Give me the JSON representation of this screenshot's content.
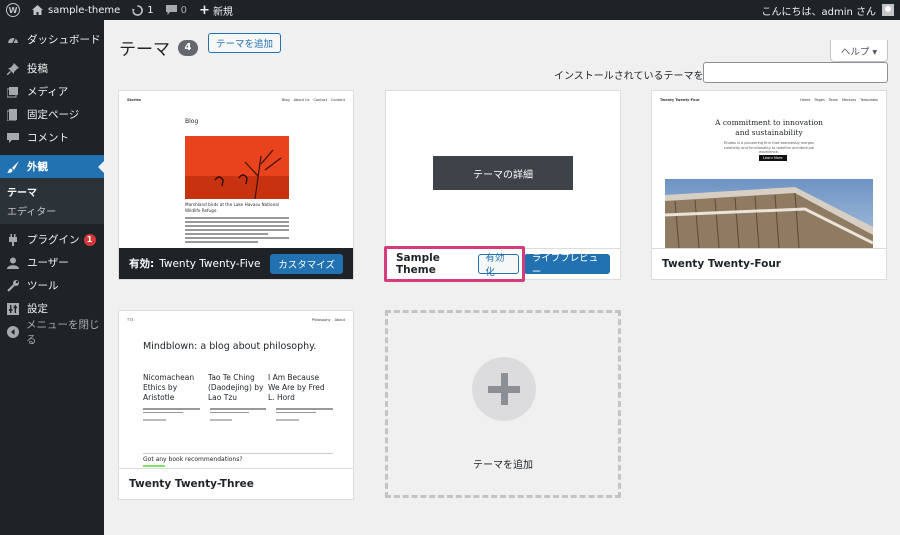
{
  "adminbar": {
    "site_name": "sample-theme",
    "updates_count": "1",
    "comments_count": "0",
    "new_label": "新規",
    "greeting": "こんにちは、admin さん"
  },
  "sidebar": {
    "items": [
      {
        "label": "ダッシュボード",
        "icon": "dashboard-icon"
      },
      {
        "label": "投稿",
        "icon": "pushpin-icon"
      },
      {
        "label": "メディア",
        "icon": "media-icon"
      },
      {
        "label": "固定ページ",
        "icon": "page-icon"
      },
      {
        "label": "コメント",
        "icon": "comment-icon"
      },
      {
        "label": "外観",
        "icon": "appearance-icon"
      },
      {
        "label": "プラグイン",
        "icon": "plugin-icon",
        "badge": "1"
      },
      {
        "label": "ユーザー",
        "icon": "user-icon"
      },
      {
        "label": "ツール",
        "icon": "tools-icon"
      },
      {
        "label": "設定",
        "icon": "settings-icon"
      }
    ],
    "submenu": [
      "テーマ",
      "エディター"
    ],
    "collapse_label": "メニューを閉じる"
  },
  "page": {
    "title": "テーマ",
    "count": "4",
    "add_button": "テーマを追加",
    "help": "ヘルプ ▾",
    "search_label": "インストールされているテーマを検索",
    "search_value": ""
  },
  "themes": [
    {
      "name": "Twenty Twenty-Five",
      "active_prefix": "有効:",
      "customize": "カスタマイズ",
      "preview": {
        "brand": "Stories",
        "nav": [
          "Blog",
          "About Us",
          "Contact",
          "Content"
        ],
        "heading": "Blog",
        "caption": "Marshland birds at the Lake Havasu National Wildlife Refuge"
      }
    },
    {
      "name": "Sample Theme",
      "details": "テーマの詳細",
      "activate": "有効化",
      "live_preview": "ライブプレビュー"
    },
    {
      "name": "Twenty Twenty-Four",
      "preview": {
        "brand": "Twenty Twenty-Four",
        "nav": [
          "Home",
          "Pages",
          "Team",
          "Mentors",
          "Templates"
        ],
        "heading": "A commitment to innovation and sustainability",
        "sub": "Études is a pioneering firm that seamlessly merges creativity and functionality to redefine architectural excellence.",
        "cta": "Learn More"
      }
    },
    {
      "name": "Twenty Twenty-Three",
      "preview": {
        "brand": "TT3",
        "nav": [
          "Philosophy",
          "About"
        ],
        "heading": "Mindblown: a blog about philosophy.",
        "posts": [
          "Nicomachean Ethics by Aristotle",
          "Tao Te Ching (Daodejing) by Lao Tzu",
          "I Am Because We Are by Fred L. Hord"
        ],
        "prompt": "Got any book recommendations?"
      }
    }
  ],
  "add_new": {
    "label": "テーマを追加"
  },
  "colors": {
    "admin_dark": "#1d2327",
    "accent": "#2271b1",
    "highlight": "#d63c7b",
    "badge": "#d63638"
  }
}
